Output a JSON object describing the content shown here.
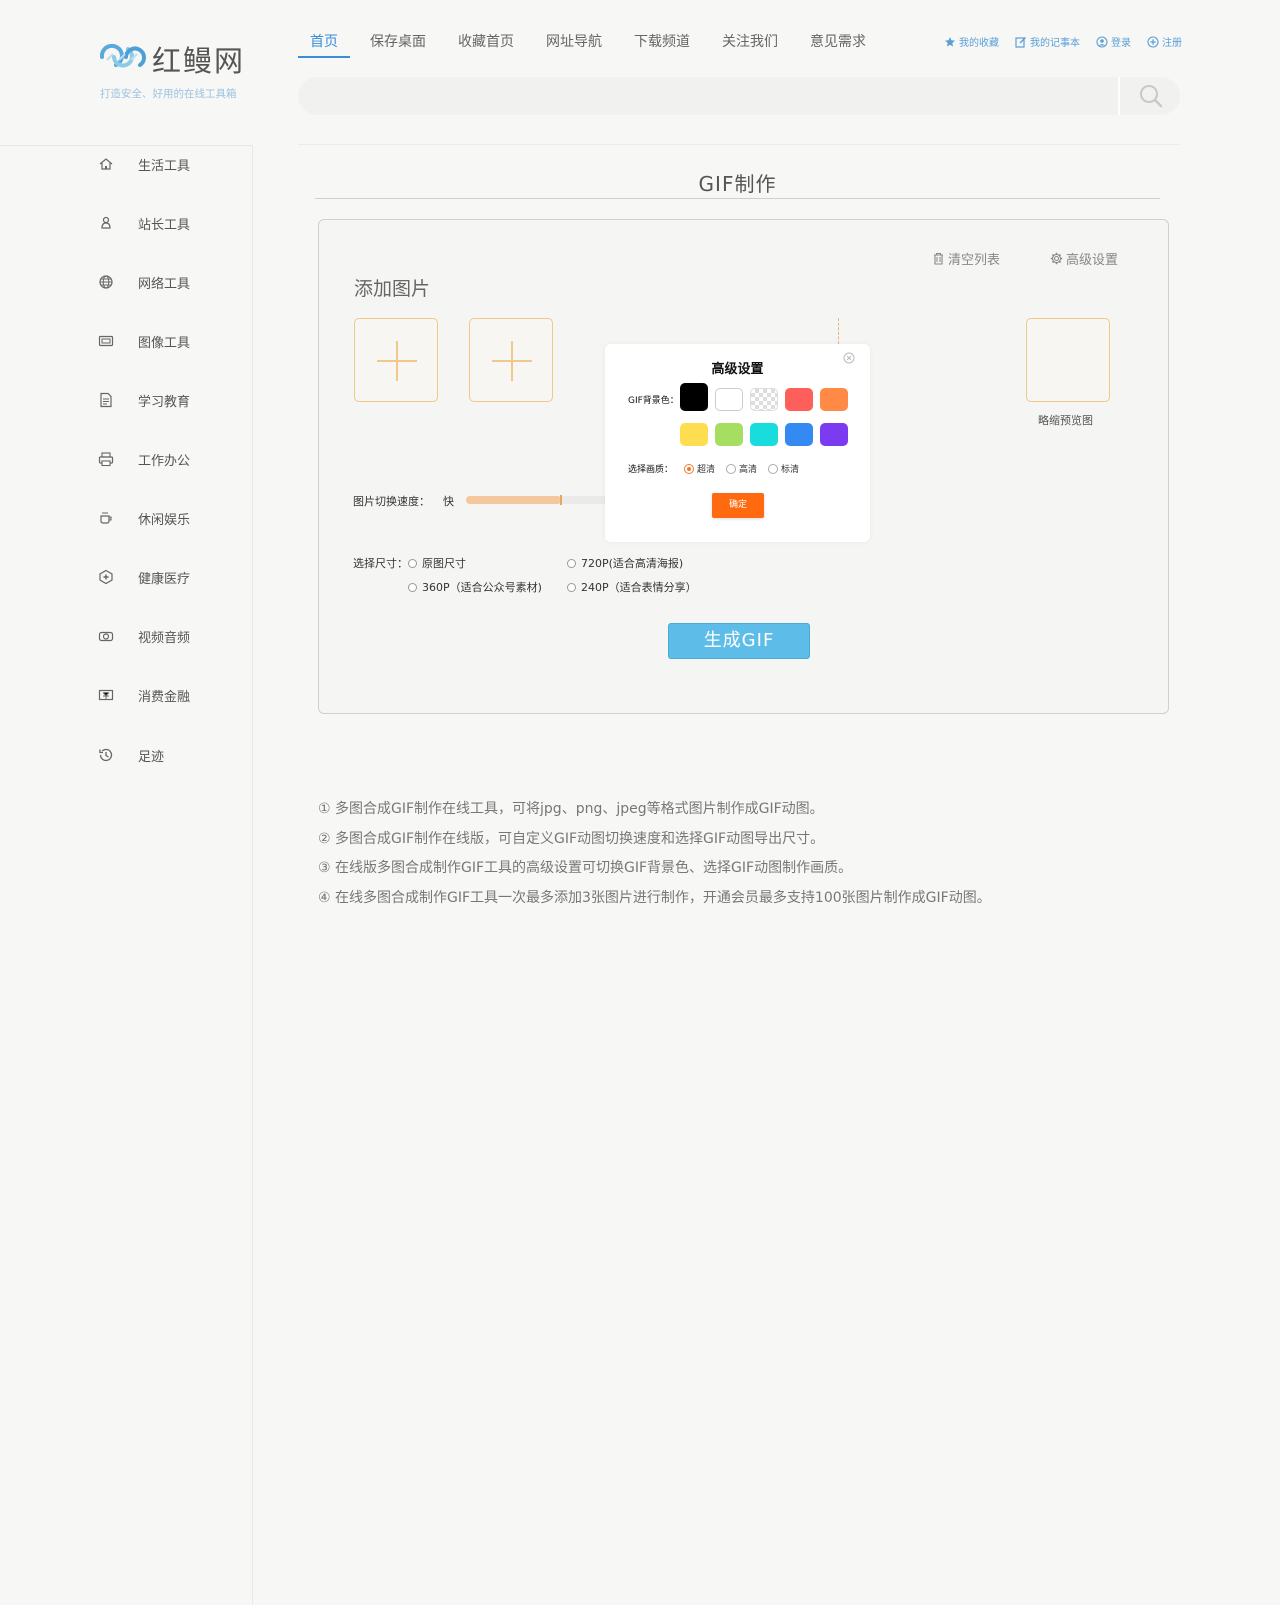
{
  "brand": {
    "name": "红鳗网",
    "slogan": "打造安全、好用的在线工具箱"
  },
  "topnav": [
    {
      "label": "首页",
      "active": true
    },
    {
      "label": "保存桌面"
    },
    {
      "label": "收藏首页"
    },
    {
      "label": "网址导航"
    },
    {
      "label": "下载频道"
    },
    {
      "label": "关注我们"
    },
    {
      "label": "意见需求"
    }
  ],
  "userlinks": {
    "favorites": "我的收藏",
    "notes": "我的记事本",
    "login": "登录",
    "register": "注册"
  },
  "search": {
    "placeholder": "",
    "value": ""
  },
  "sidebar": {
    "items": [
      {
        "label": "生活工具",
        "icon": "home-icon"
      },
      {
        "label": "站长工具",
        "icon": "webmaster-icon"
      },
      {
        "label": "网络工具",
        "icon": "globe-icon"
      },
      {
        "label": "图像工具",
        "icon": "image-icon"
      },
      {
        "label": "学习教育",
        "icon": "document-icon"
      },
      {
        "label": "工作办公",
        "icon": "printer-icon"
      },
      {
        "label": "休闲娱乐",
        "icon": "coffee-icon"
      },
      {
        "label": "健康医疗",
        "icon": "health-icon"
      },
      {
        "label": "视频音频",
        "icon": "camera-icon"
      },
      {
        "label": "消费金融",
        "icon": "finance-icon"
      },
      {
        "label": "足迹",
        "icon": "history-icon"
      }
    ]
  },
  "main": {
    "title": "GIF制作",
    "clear_list": "清空列表",
    "advanced_settings": "高级设置",
    "add_images": "添加图片",
    "preview_label": "略缩预览图",
    "speed_label": "图片切换速度：",
    "speed_fast": "快",
    "speed_level": 0.53,
    "size_label": "选择尺寸：",
    "size_options": [
      "原图尺寸",
      "720P(适合高清海报)",
      "360P（适合公众号素材)",
      "240P（适合表情分享）"
    ],
    "generate_button": "生成GIF"
  },
  "modal": {
    "title": "高级设置",
    "bg_label": "GIF背景色：",
    "colors": [
      "#000000",
      "#ffffff",
      "transparent",
      "#ff5f5b",
      "#ff8a46",
      "#ffdd50",
      "#a5de60",
      "#19dcdc",
      "#3489f3",
      "#7b3bf0"
    ],
    "selected_color": "#000000",
    "quality_label": "选择画质：",
    "quality_options": [
      "超清",
      "高清",
      "标清"
    ],
    "quality_selected": "超清",
    "confirm": "确定"
  },
  "description": [
    "① 多图合成GIF制作在线工具，可将jpg、png、jpeg等格式图片制作成GIF动图。",
    "② 多图合成GIF制作在线版，可自定义GIF动图切换速度和选择GIF动图导出尺寸。",
    "③ 在线版多图合成制作GIF工具的高级设置可切换GIF背景色、选择GIF动图制作画质。",
    "④ 在线多图合成制作GIF工具一次最多添加3张图片进行制作，开通会员最多支持100张图片制作成GIF动图。"
  ]
}
